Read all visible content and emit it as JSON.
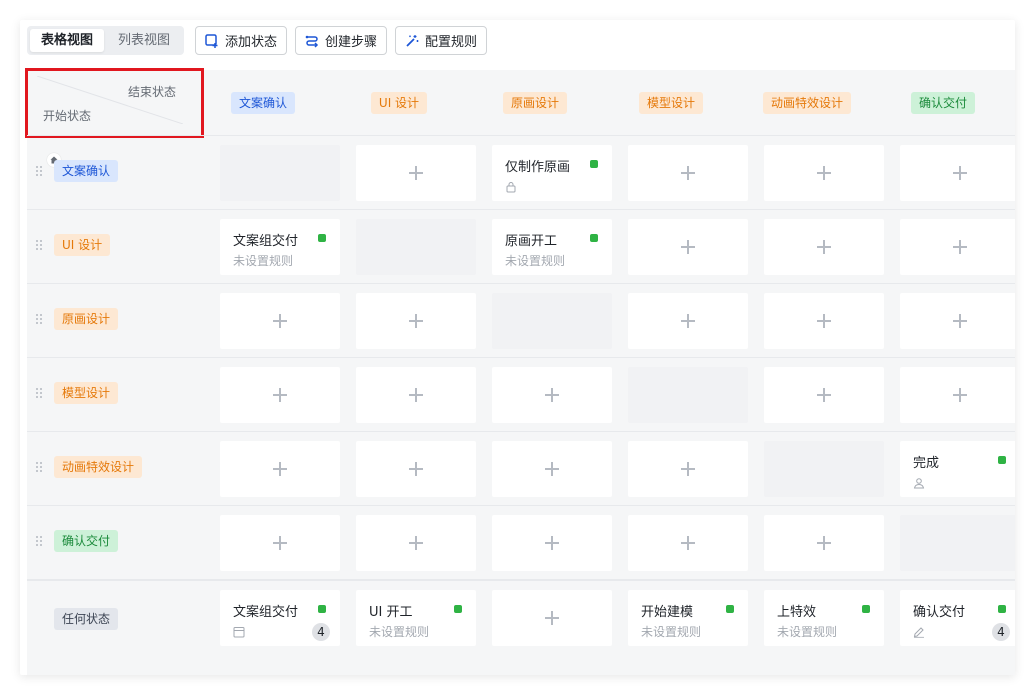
{
  "toolbar": {
    "view_table": "表格视图",
    "view_list": "列表视图",
    "add_state": "添加状态",
    "create_step": "创建步骤",
    "config_rules": "配置规则"
  },
  "corner": {
    "end_label": "结束状态",
    "start_label": "开始状态"
  },
  "columns": [
    {
      "label": "文案确认",
      "color": "blue"
    },
    {
      "label": "UI 设计",
      "color": "orange"
    },
    {
      "label": "原画设计",
      "color": "orange"
    },
    {
      "label": "模型设计",
      "color": "orange"
    },
    {
      "label": "动画特效设计",
      "color": "orange"
    },
    {
      "label": "确认交付",
      "color": "green"
    }
  ],
  "rows": [
    {
      "label": "文案确认",
      "color": "blue",
      "home": true
    },
    {
      "label": "UI 设计",
      "color": "orange"
    },
    {
      "label": "原画设计",
      "color": "orange"
    },
    {
      "label": "模型设计",
      "color": "orange"
    },
    {
      "label": "动画特效设计",
      "color": "orange"
    },
    {
      "label": "确认交付",
      "color": "green"
    },
    {
      "label": "任何状态",
      "color": "gray"
    }
  ],
  "cells": {
    "r0c2": {
      "title": "仅制作原画",
      "icon": "lock-icon"
    },
    "r1c0": {
      "title": "文案组交付",
      "sub": "未设置规则"
    },
    "r1c2": {
      "title": "原画开工",
      "sub": "未设置规则"
    },
    "r4c5": {
      "title": "完成",
      "icon": "user-icon"
    },
    "r6c0": {
      "title": "文案组交付",
      "icon": "calendar-icon",
      "count": "4"
    },
    "r6c1": {
      "title": "UI 开工",
      "sub": "未设置规则"
    },
    "r6c3": {
      "title": "开始建模",
      "sub": "未设置规则"
    },
    "r6c4": {
      "title": "上特效",
      "sub": "未设置规则"
    },
    "r6c5": {
      "title": "确认交付",
      "icon": "edit-icon",
      "count": "4"
    }
  },
  "colors": {
    "status_dot": "#2fb344",
    "highlight_box": "#e1171f"
  }
}
